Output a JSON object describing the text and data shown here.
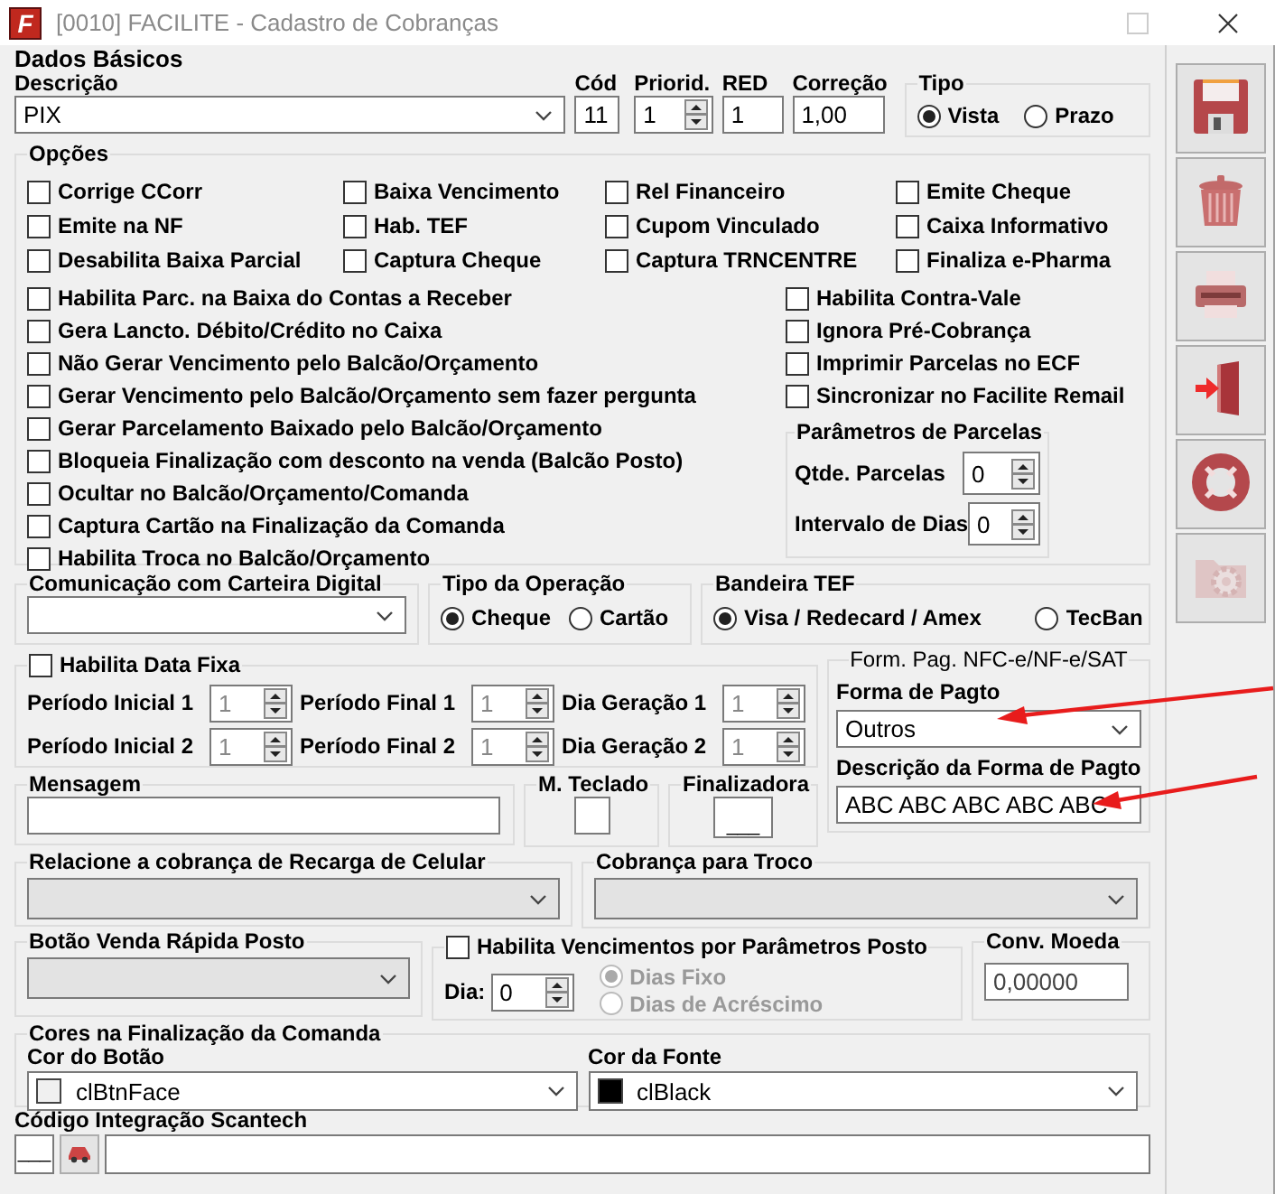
{
  "window": {
    "logo": "F",
    "title": "[0010] FACILITE - Cadastro de Cobranças"
  },
  "dados_basicos": {
    "title": "Dados Básicos",
    "fields": [
      {
        "kind": "combo",
        "label": "Descrição",
        "value": "PIX"
      },
      {
        "kind": "text",
        "label": "Cód",
        "value": "11"
      },
      {
        "kind": "spin",
        "label": "Priorid.",
        "value": "1"
      },
      {
        "kind": "text",
        "label": "RED",
        "value": "1"
      },
      {
        "kind": "text",
        "label": "Correção",
        "value": "1,00"
      }
    ],
    "tipo": {
      "title": "Tipo",
      "options": [
        {
          "label": "Vista",
          "selected": true
        },
        {
          "label": "Prazo",
          "selected": false
        }
      ]
    }
  },
  "opcoes": {
    "title": "Opções",
    "grid": [
      {
        "label": "Corrige CCorr",
        "checked": false
      },
      {
        "label": "Baixa Vencimento",
        "checked": false
      },
      {
        "label": "Rel Financeiro",
        "checked": false
      },
      {
        "label": "Emite Cheque",
        "checked": false
      },
      {
        "label": "Emite na NF",
        "checked": false
      },
      {
        "label": "Hab. TEF",
        "checked": false
      },
      {
        "label": "Cupom Vinculado",
        "checked": false
      },
      {
        "label": "Caixa Informativo",
        "checked": false
      },
      {
        "label": "Desabilita Baixa Parcial",
        "checked": false
      },
      {
        "label": "Captura Cheque",
        "checked": false
      },
      {
        "label": "Captura TRNCENTRE",
        "checked": false
      },
      {
        "label": "Finaliza e-Pharma",
        "checked": false
      }
    ],
    "left": [
      {
        "label": "Habilita Parc. na Baixa do Contas a Receber",
        "checked": false
      },
      {
        "label": "Gera Lancto. Débito/Crédito no Caixa",
        "checked": false
      },
      {
        "label": "Não Gerar Vencimento pelo Balcão/Orçamento",
        "checked": false
      },
      {
        "label": "Gerar Vencimento pelo Balcão/Orçamento sem fazer pergunta",
        "checked": false
      },
      {
        "label": "Gerar Parcelamento Baixado pelo Balcão/Orçamento",
        "checked": false
      },
      {
        "label": "Bloqueia Finalização com desconto na venda (Balcão Posto)",
        "checked": false
      },
      {
        "label": "Ocultar no Balcão/Orçamento/Comanda",
        "checked": false
      },
      {
        "label": "Captura Cartão na Finalização da Comanda",
        "checked": false
      },
      {
        "label": "Habilita Troca no Balcão/Orçamento",
        "checked": false
      }
    ],
    "right": [
      {
        "label": "Habilita Contra-Vale",
        "checked": false
      },
      {
        "label": "Ignora Pré-Cobrança",
        "checked": false
      },
      {
        "label": "Imprimir Parcelas no ECF",
        "checked": false
      },
      {
        "label": "Sincronizar no Facilite Remail",
        "checked": false
      }
    ],
    "parcelas": {
      "title": "Parâmetros de Parcelas",
      "fields": [
        {
          "label": "Qtde. Parcelas",
          "value": "0"
        },
        {
          "label": "Intervalo de Dias",
          "value": "0"
        }
      ]
    }
  },
  "comunicacao": {
    "title": "Comunicação com Carteira Digital"
  },
  "tipo_operacao": {
    "title": "Tipo da Operação",
    "options": [
      {
        "label": "Cheque",
        "selected": true
      },
      {
        "label": "Cartão",
        "selected": false
      }
    ]
  },
  "bandeira_tef": {
    "title": "Bandeira TEF",
    "options": [
      {
        "label": "Visa / Redecard / Amex",
        "selected": true
      },
      {
        "label": "TecBan",
        "selected": false
      }
    ]
  },
  "data_fixa": {
    "label": "Habilita Data Fixa",
    "checked": false,
    "fields_disabled": true,
    "fields": [
      {
        "label": "Período Inicial 1",
        "value": "1"
      },
      {
        "label": "Período Final 1",
        "value": "1"
      },
      {
        "label": "Dia Geração 1",
        "value": "1"
      },
      {
        "label": "Período Inicial 2",
        "value": "1"
      },
      {
        "label": "Período Final 2",
        "value": "1"
      },
      {
        "label": "Dia Geração 2",
        "value": "1"
      }
    ]
  },
  "mensagem": {
    "title": "Mensagem"
  },
  "m_teclado": {
    "title": "M. Teclado"
  },
  "finalizadora": {
    "title": "Finalizadora",
    "key": "___"
  },
  "nfce": {
    "title": "Form. Pag. NFC-e/NF-e/SAT",
    "forma": {
      "label": "Forma de Pagto",
      "value": "Outros"
    },
    "descricao": {
      "label": "Descrição da Forma de Pagto",
      "value": "ABC ABC ABC ABC ABC"
    }
  },
  "recarga": {
    "title": "Relacione a cobrança de Recarga de Celular",
    "disabled": true
  },
  "troco": {
    "title": "Cobrança para Troco",
    "disabled": true
  },
  "venda_rapida": {
    "title": "Botão Venda Rápida Posto",
    "disabled": true
  },
  "vencimentos": {
    "label": "Habilita Vencimentos por Parâmetros Posto",
    "checked": false,
    "dia": {
      "label": "Dia:",
      "value": "0"
    },
    "options_disabled": true,
    "options": [
      {
        "label": "Dias Fixo",
        "selected": true
      },
      {
        "label": "Dias de Acréscimo",
        "selected": false
      }
    ]
  },
  "conv_moeda": {
    "title": "Conv. Moeda",
    "value": "0,00000"
  },
  "cores": {
    "title": "Cores na Finalização da Comanda",
    "fields": [
      {
        "label": "Cor do Botão",
        "value": "clBtnFace",
        "color": "#f0f0f0"
      },
      {
        "label": "Cor da Fonte",
        "value": "clBlack",
        "color": "#000000"
      }
    ]
  },
  "scantech": {
    "label": "Código Integração Scantech",
    "key": "___"
  },
  "toolbar": [
    {
      "kind": "save",
      "disabled": false
    },
    {
      "kind": "delete",
      "disabled": false
    },
    {
      "kind": "print",
      "disabled": false
    },
    {
      "kind": "exit",
      "disabled": false
    },
    {
      "kind": "help",
      "disabled": false
    },
    {
      "kind": "settings",
      "disabled": true
    }
  ]
}
